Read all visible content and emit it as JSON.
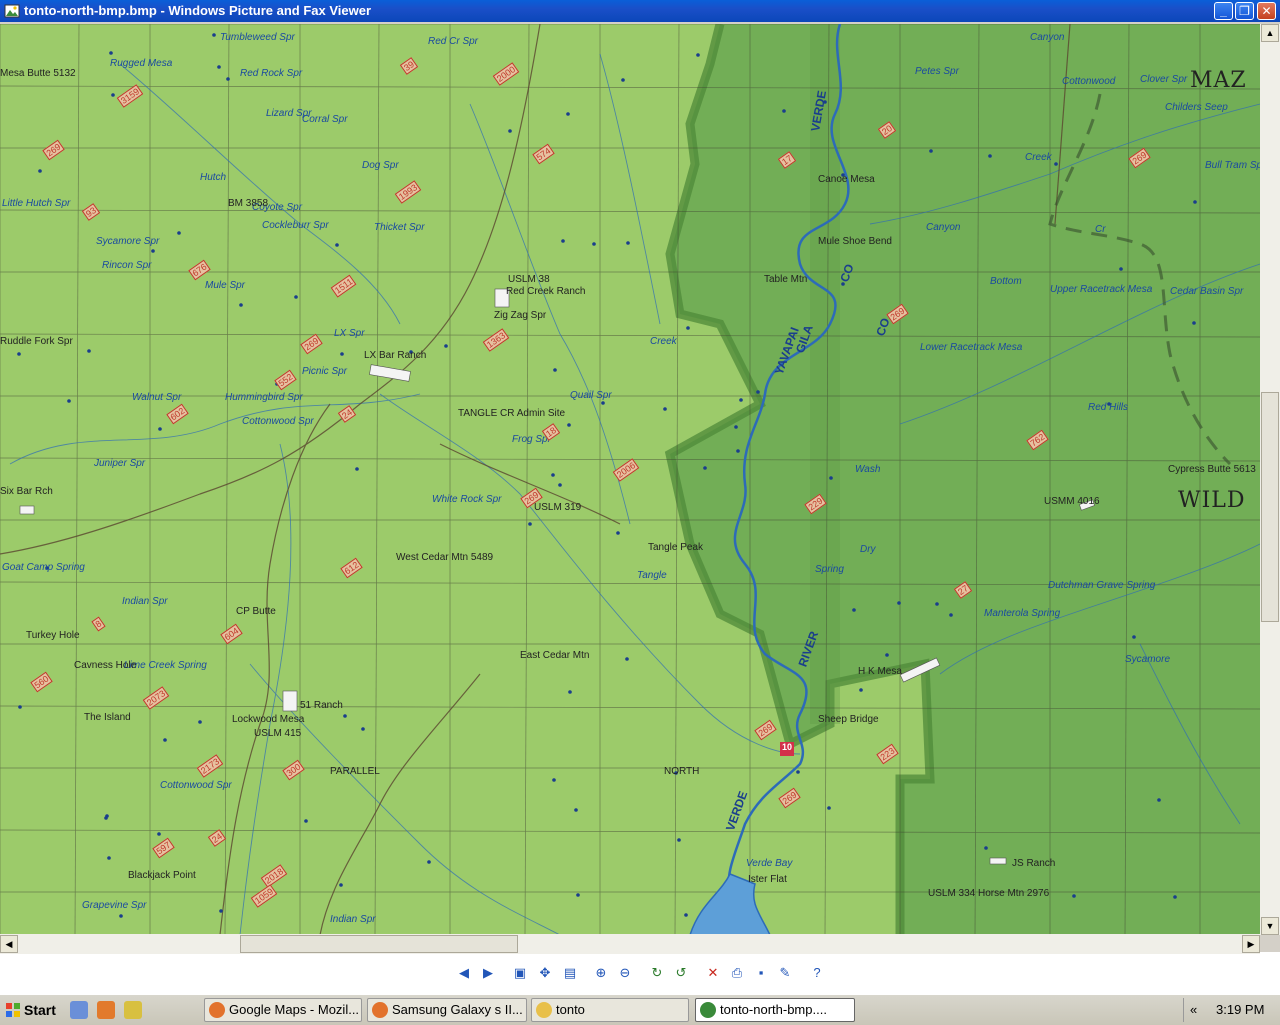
{
  "window": {
    "title": "tonto-north-bmp.bmp - Windows Picture and Fax Viewer",
    "minimize": "_",
    "maximize": "❐",
    "close": "✕"
  },
  "map": {
    "labels_blue": [
      "Tumbleweed Spr",
      "Red Cr Spr",
      "Rugged Mesa",
      "Red Rock Spr",
      "Lizard Spr",
      "Corral Spr",
      "Dog Spr",
      "Hutch",
      "Little Hutch Spr",
      "Coyote Spr",
      "Cockleburr Spr",
      "Thicket Spr",
      "Sycamore Spr",
      "Rincon Spr",
      "Mule Spr",
      "LX Spr",
      "Picnic Spr",
      "Hummingbird Spr",
      "Cottonwood Spr",
      "Walnut Spr",
      "Juniper Spr",
      "Quail Spr",
      "Frog Spr",
      "White Rock Spr",
      "Goat Camp Spring",
      "Indian Spr",
      "Lime Creek Spring",
      "Cottonwood Spr",
      "Grapevine Spr",
      "Indian Spr",
      "Cedar Basin Spr",
      "Childers Seep",
      "Bull Tram Spr",
      "Clover Spr",
      "Petes Spr",
      "Dutchman Grave Spring",
      "Manterola Spring",
      "Verde Bay",
      "Creek",
      "Tangle",
      "Canyon",
      "Creek",
      "Wash",
      "Dry",
      "Spring",
      "Sycamore",
      "Upper Racetrack Mesa",
      "Lower Racetrack Mesa",
      "Bottom",
      "Red Hills",
      "Cottonwood",
      "Canyon",
      "Cr"
    ],
    "labels_black": [
      "Mesa Butte 5132",
      "Ruddle Fork Spr",
      "Six Bar Rch",
      "Turkey Hole",
      "Cavness Hole",
      "The Island",
      "Lockwood Mesa",
      "Blackjack Point",
      "LX Bar Ranch",
      "Red Creek Ranch",
      "Zig Zag Spr",
      "TANGLE CR Admin Site",
      "USLM 319",
      "West Cedar Mtn 5489",
      "East Cedar Mtn",
      "Tangle Peak",
      "CP Butte",
      "51 Ranch",
      "USLM 415",
      "PARALLEL",
      "NORTH",
      "Canoe Mesa",
      "Table Mtn",
      "Mule Shoe Bend",
      "H K Mesa",
      "Sheep Bridge",
      "Ister Flat",
      "USMM 4016",
      "Cypress Butte 5613",
      "USLM 334 Horse Mtn 2976",
      "JS Ranch",
      "BM 3858",
      "USLM 38"
    ],
    "big_labels": [
      "MAZ",
      "WILD"
    ],
    "river_labels": [
      "VERDE",
      "YAVAPAI",
      "GILA",
      "CO",
      "CO",
      "RIVER",
      "VERDE"
    ],
    "routes": [
      "3159",
      "269",
      "39",
      "2000",
      "574",
      "1993",
      "93",
      "676",
      "1511",
      "269",
      "1363",
      "552",
      "24",
      "602",
      "18",
      "2006",
      "269",
      "612",
      "8",
      "604",
      "2073",
      "560",
      "2173",
      "300",
      "597",
      "24",
      "2018",
      "1059",
      "17",
      "20",
      "269",
      "269",
      "229",
      "269",
      "223",
      "269",
      "762",
      "27"
    ],
    "hwy_marker": "10"
  },
  "toolbar": {
    "buttons": [
      {
        "icon": "previous-image-icon",
        "glyph": "◀"
      },
      {
        "icon": "next-image-icon",
        "glyph": "▶"
      },
      {
        "icon": "best-fit-icon",
        "glyph": "▣"
      },
      {
        "icon": "actual-size-icon",
        "glyph": "✥"
      },
      {
        "icon": "slideshow-icon",
        "glyph": "▤"
      },
      {
        "icon": "zoom-in-icon",
        "glyph": "⊕"
      },
      {
        "icon": "zoom-out-icon",
        "glyph": "⊖"
      },
      {
        "icon": "rotate-clockwise-icon",
        "glyph": "↻"
      },
      {
        "icon": "rotate-counterclockwise-icon",
        "glyph": "↺"
      },
      {
        "icon": "delete-icon",
        "glyph": "✕"
      },
      {
        "icon": "print-icon",
        "glyph": "⎙"
      },
      {
        "icon": "save-icon",
        "glyph": "▪"
      },
      {
        "icon": "edit-icon",
        "glyph": "✎"
      },
      {
        "icon": "help-icon",
        "glyph": "?"
      }
    ]
  },
  "taskbar": {
    "start_label": "Start",
    "tasks": [
      {
        "label": "Google Maps - Mozil...",
        "icon": "firefox-icon",
        "active": false
      },
      {
        "label": "Samsung Galaxy s II...",
        "icon": "firefox-icon",
        "active": false
      },
      {
        "label": "tonto",
        "icon": "folder-icon",
        "active": false
      },
      {
        "label": "tonto-north-bmp....",
        "icon": "picture-viewer-icon",
        "active": true
      }
    ],
    "tray_chevron": "«",
    "clock": "3:19 PM"
  },
  "colors": {
    "map_light": "#9ccb6a",
    "map_dark": "#6faa52",
    "map_border": "#4f8a3a",
    "water": "#2d6bb8",
    "grid": "#3c3c30",
    "route_red": "#c0392b",
    "titlebar_blue": "#0b47b9"
  }
}
